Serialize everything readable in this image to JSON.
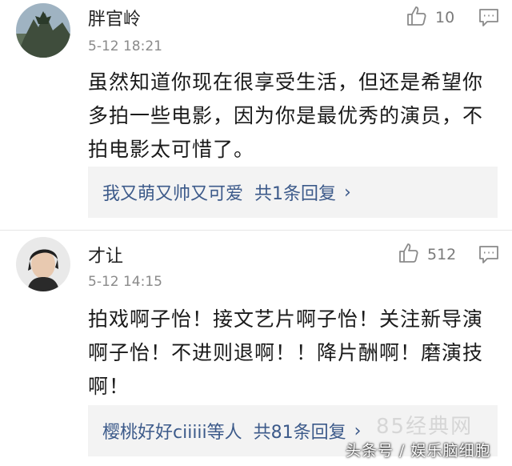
{
  "comments": [
    {
      "username": "胖官岭",
      "timestamp": "5-12 18:21",
      "likes": "10",
      "text": "虽然知道你现在很享受生活，但还是希望你多拍一些电影，因为你是最优秀的演员，不拍电影太可惜了。",
      "replies": {
        "user": "我又萌又帅又可爱",
        "count": "共1条回复"
      }
    },
    {
      "username": "才让",
      "timestamp": "5-12 14:15",
      "likes": "512",
      "text": "拍戏啊子怡！接文艺片啊子怡！关注新导演啊子怡！不进则退啊！！降片酬啊！磨演技啊！",
      "replies": {
        "user": "樱桃好好ciiiii等人",
        "count": "共81条回复"
      }
    }
  ],
  "icons": {
    "like": "thumbs-up-icon",
    "reply": "comment-bubble-icon",
    "chevron": "chevron-right-icon"
  },
  "colors": {
    "link": "#3c5a8a",
    "meta": "#8a8a8a",
    "reply_bg": "#f3f3f3"
  },
  "watermark": {
    "site": "85经典网",
    "source": "头条号 / 娱乐脑细胞"
  }
}
